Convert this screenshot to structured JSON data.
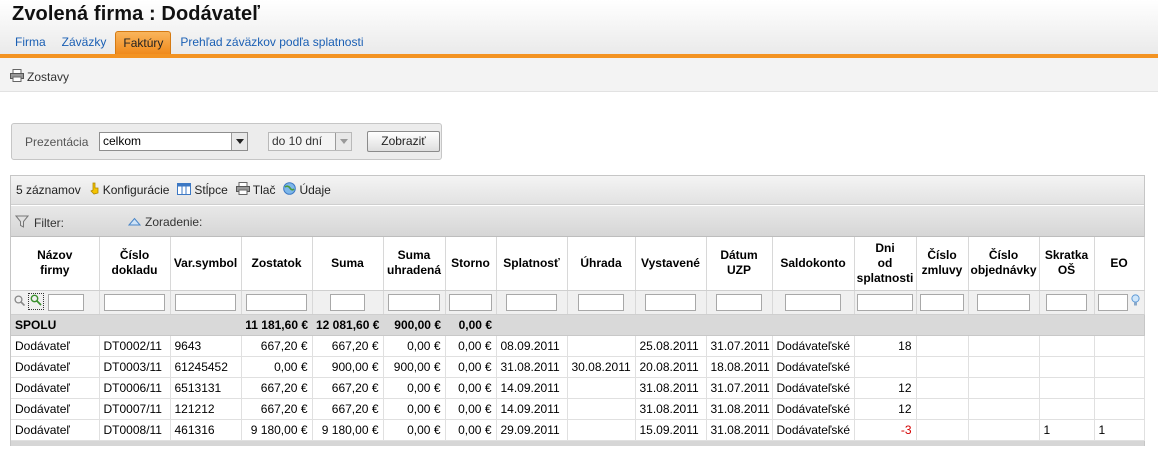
{
  "header": {
    "title": "Zvolená firma :  Dodávateľ"
  },
  "tabs": [
    {
      "label": "Firma",
      "active": false
    },
    {
      "label": "Záväzky",
      "active": false
    },
    {
      "label": "Faktúry",
      "active": true
    },
    {
      "label": "Prehľad záväzkov podľa splatnosti",
      "active": false
    }
  ],
  "subbar": {
    "zostavy_label": "Zostavy"
  },
  "filter_panel": {
    "label": "Prezentácia",
    "presentation_value": "celkom",
    "period_value": "do 10 dní",
    "button_label": "Zobraziť"
  },
  "toolbar": {
    "count_label": "5 záznamov",
    "config_label": "Konfigurácie",
    "columns_label": "Stĺpce",
    "print_label": "Tlač",
    "data_label": "Údaje"
  },
  "filterbar": {
    "filter_label": "Filter:",
    "sort_label": "Zoradenie:"
  },
  "table": {
    "headers": [
      "Názov\nfirmy",
      "Číslo\ndokladu",
      "Var.symbol",
      "Zostatok",
      "Suma",
      "Suma\nuhradená",
      "Storno",
      "Splatnosť",
      "Úhrada",
      "Vystavené",
      "Dátum\nUZP",
      "Saldokonto",
      "Dni\nod\nsplatnosti",
      "Číslo\nzmluvy",
      "Číslo\nobjednávky",
      "Skratka\nOŠ",
      "EO"
    ],
    "sum_row": {
      "label": "SPOLU",
      "zostatok": "11 181,60 €",
      "suma": "12 081,60 €",
      "uhradena": "900,00 €",
      "storno": "0,00 €"
    },
    "rows": [
      [
        "Dodávateľ",
        "DT0002/11",
        "9643",
        "667,20 €",
        "667,20 €",
        "0,00 €",
        "0,00 €",
        "08.09.2011",
        "",
        "25.08.2011",
        "31.07.2011",
        "Dodávateľské",
        "18",
        "",
        "",
        "",
        ""
      ],
      [
        "Dodávateľ",
        "DT0003/11",
        "61245452",
        "0,00 €",
        "900,00 €",
        "900,00 €",
        "0,00 €",
        "31.08.2011",
        "30.08.2011",
        "20.08.2011",
        "18.08.2011",
        "Dodávateľské",
        "",
        "",
        "",
        "",
        ""
      ],
      [
        "Dodávateľ",
        "DT0006/11",
        "6513131",
        "667,20 €",
        "667,20 €",
        "0,00 €",
        "0,00 €",
        "14.09.2011",
        "",
        "31.08.2011",
        "31.07.2011",
        "Dodávateľské",
        "12",
        "",
        "",
        "",
        ""
      ],
      [
        "Dodávateľ",
        "DT0007/11",
        "121212",
        "667,20 €",
        "667,20 €",
        "0,00 €",
        "0,00 €",
        "14.09.2011",
        "",
        "31.08.2011",
        "31.08.2011",
        "Dodávateľské",
        "12",
        "",
        "",
        "",
        ""
      ],
      [
        "Dodávateľ",
        "DT0008/11",
        "461316",
        "9 180,00 €",
        "9 180,00 €",
        "0,00 €",
        "0,00 €",
        "29.09.2011",
        "",
        "15.09.2011",
        "31.08.2011",
        "Dodávateľské",
        "-3",
        "",
        "",
        "1",
        "1"
      ]
    ]
  },
  "colors": {
    "accent": "#f39322",
    "link": "#1a5fb4",
    "negative": "#d40000"
  }
}
